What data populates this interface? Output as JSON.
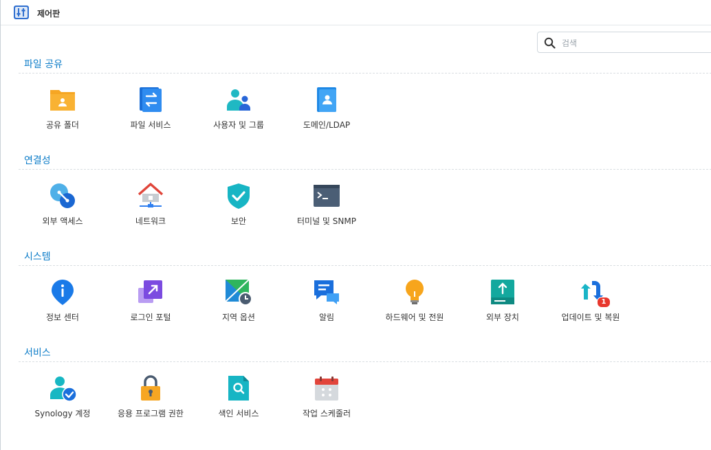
{
  "app": {
    "title": "제어판"
  },
  "search": {
    "placeholder": "검색"
  },
  "sections": [
    {
      "title": "파일 공유",
      "items": [
        {
          "label": "공유 폴더",
          "icon": "shared-folder-icon"
        },
        {
          "label": "파일 서비스",
          "icon": "file-services-icon"
        },
        {
          "label": "사용자 및 그룹",
          "icon": "user-group-icon"
        },
        {
          "label": "도메인/LDAP",
          "icon": "domain-ldap-icon"
        }
      ]
    },
    {
      "title": "연결성",
      "items": [
        {
          "label": "외부 액세스",
          "icon": "external-access-icon"
        },
        {
          "label": "네트워크",
          "icon": "network-icon"
        },
        {
          "label": "보안",
          "icon": "security-shield-icon"
        },
        {
          "label": "터미널 및 SNMP",
          "icon": "terminal-icon"
        }
      ]
    },
    {
      "title": "시스템",
      "items": [
        {
          "label": "정보 센터",
          "icon": "info-center-icon"
        },
        {
          "label": "로그인 포털",
          "icon": "login-portal-icon"
        },
        {
          "label": "지역 옵션",
          "icon": "regional-options-icon"
        },
        {
          "label": "알림",
          "icon": "notification-icon"
        },
        {
          "label": "하드웨어 및 전원",
          "icon": "hardware-power-icon"
        },
        {
          "label": "외부 장치",
          "icon": "external-devices-icon"
        },
        {
          "label": "업데이트 및 복원",
          "icon": "update-restore-icon",
          "badge": "1"
        }
      ]
    },
    {
      "title": "서비스",
      "items": [
        {
          "label": "Synology 계정",
          "icon": "synology-account-icon"
        },
        {
          "label": "응용 프로그램 권한",
          "icon": "application-privileges-icon"
        },
        {
          "label": "색인 서비스",
          "icon": "indexing-service-icon"
        },
        {
          "label": "작업 스케줄러",
          "icon": "task-scheduler-icon"
        }
      ]
    }
  ]
}
